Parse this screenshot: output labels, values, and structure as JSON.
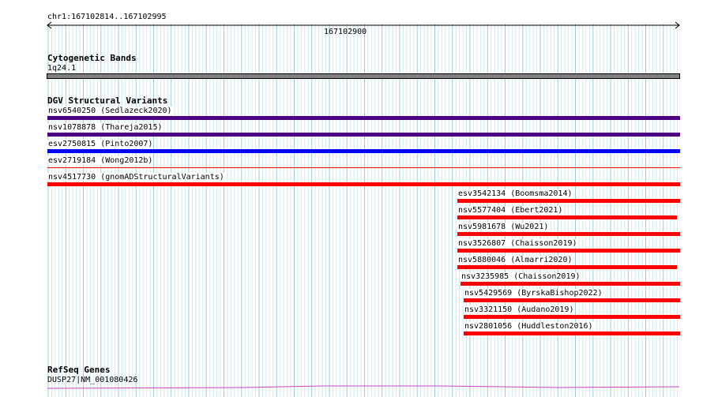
{
  "ruler": {
    "range_label": "chr1:167102814..167102995",
    "tick_label": "167102900"
  },
  "tracks": {
    "cytobands": {
      "title": "Cytogenetic Bands",
      "band_label": "1q24.1",
      "band_color": "#808080"
    },
    "dgv": {
      "title": "DGV Structural Variants",
      "colors": {
        "purple": "#4b0082",
        "blue": "#0000ff",
        "red": "#ff0000"
      },
      "features": [
        {
          "label": "nsv6540250 (Sedlazeck2020)",
          "color": "purple"
        },
        {
          "label": "nsv1078878 (Thareja2015)",
          "color": "purple"
        },
        {
          "label": "esv2750815 (Pinto2007)",
          "color": "blue"
        },
        {
          "label": "esv2719184 (Wong2012b)",
          "color": "red"
        },
        {
          "label": "nsv4517730 (gnomADStructuralVariants)",
          "color": "red"
        },
        {
          "label": "esv3542134 (Boomsma2014)",
          "color": "red"
        },
        {
          "label": "nsv5577404 (Ebert2021)",
          "color": "red"
        },
        {
          "label": "nsv5981678 (Wu2021)",
          "color": "red"
        },
        {
          "label": "nsv3526807 (Chaisson2019)",
          "color": "red"
        },
        {
          "label": "nsv5880046 (Almarri2020)",
          "color": "red"
        },
        {
          "label": "nsv3235985 (Chaisson2019)",
          "color": "red"
        },
        {
          "label": "nsv5429569 (ByrskaBishop2022)",
          "color": "red"
        },
        {
          "label": "nsv3321150 (Audano2019)",
          "color": "red"
        },
        {
          "label": "nsv2801056 (Huddleston2016)",
          "color": "red"
        }
      ]
    },
    "refseq": {
      "title": "RefSeq Genes",
      "gene_label": "DUSP27|NM_001080426",
      "gene_color": "#cc44cc"
    }
  }
}
